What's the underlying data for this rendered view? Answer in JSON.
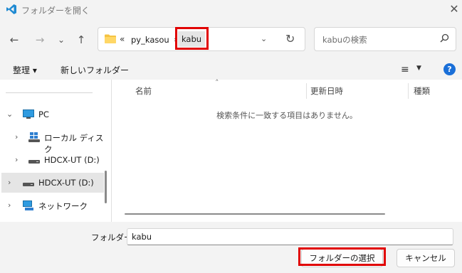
{
  "window": {
    "title": "フォルダーを開く",
    "close_glyph": "✕"
  },
  "nav": {
    "back_glyph": "←",
    "forward_glyph": "→",
    "recent_glyph": "⌄",
    "up_glyph": "↑"
  },
  "address": {
    "overflow_glyph": "«",
    "crumbs": [
      "py_kasou",
      "kabu"
    ],
    "separator": "›",
    "dropdown_glyph": "⌄",
    "refresh_glyph": "↻"
  },
  "search": {
    "placeholder": "kabuの検索"
  },
  "commands": {
    "organize": "整理 ▾",
    "new_folder": "新しいフォルダー",
    "view_glyph": "≡",
    "view_dd": "▼",
    "help": "?"
  },
  "navpane": {
    "items": [
      {
        "chevron": "⌄",
        "label": "PC",
        "icon": "monitor-icon"
      },
      {
        "chevron": "›",
        "label": "ローカル ディスク",
        "icon": "windows-drive-icon"
      },
      {
        "chevron": "›",
        "label": "HDCX-UT (D:)",
        "icon": "drive-icon"
      },
      {
        "chevron": "›",
        "label": "HDCX-UT (D:)",
        "icon": "drive-icon",
        "selected": true
      },
      {
        "chevron": "›",
        "label": "ネットワーク",
        "icon": "network-icon"
      }
    ]
  },
  "filelist": {
    "columns": [
      "名前",
      "更新日時",
      "種類"
    ],
    "sort_glyph": "˄",
    "empty_message": "検索条件に一致する項目はありません。"
  },
  "footer": {
    "folder_label": "フォルダー:",
    "folder_value": "kabu",
    "select_button": "フォルダーの選択",
    "cancel_button": "キャンセル"
  },
  "colors": {
    "accent": "#1a6fd8",
    "highlight": "#e10000",
    "folder": "#f5c342"
  }
}
